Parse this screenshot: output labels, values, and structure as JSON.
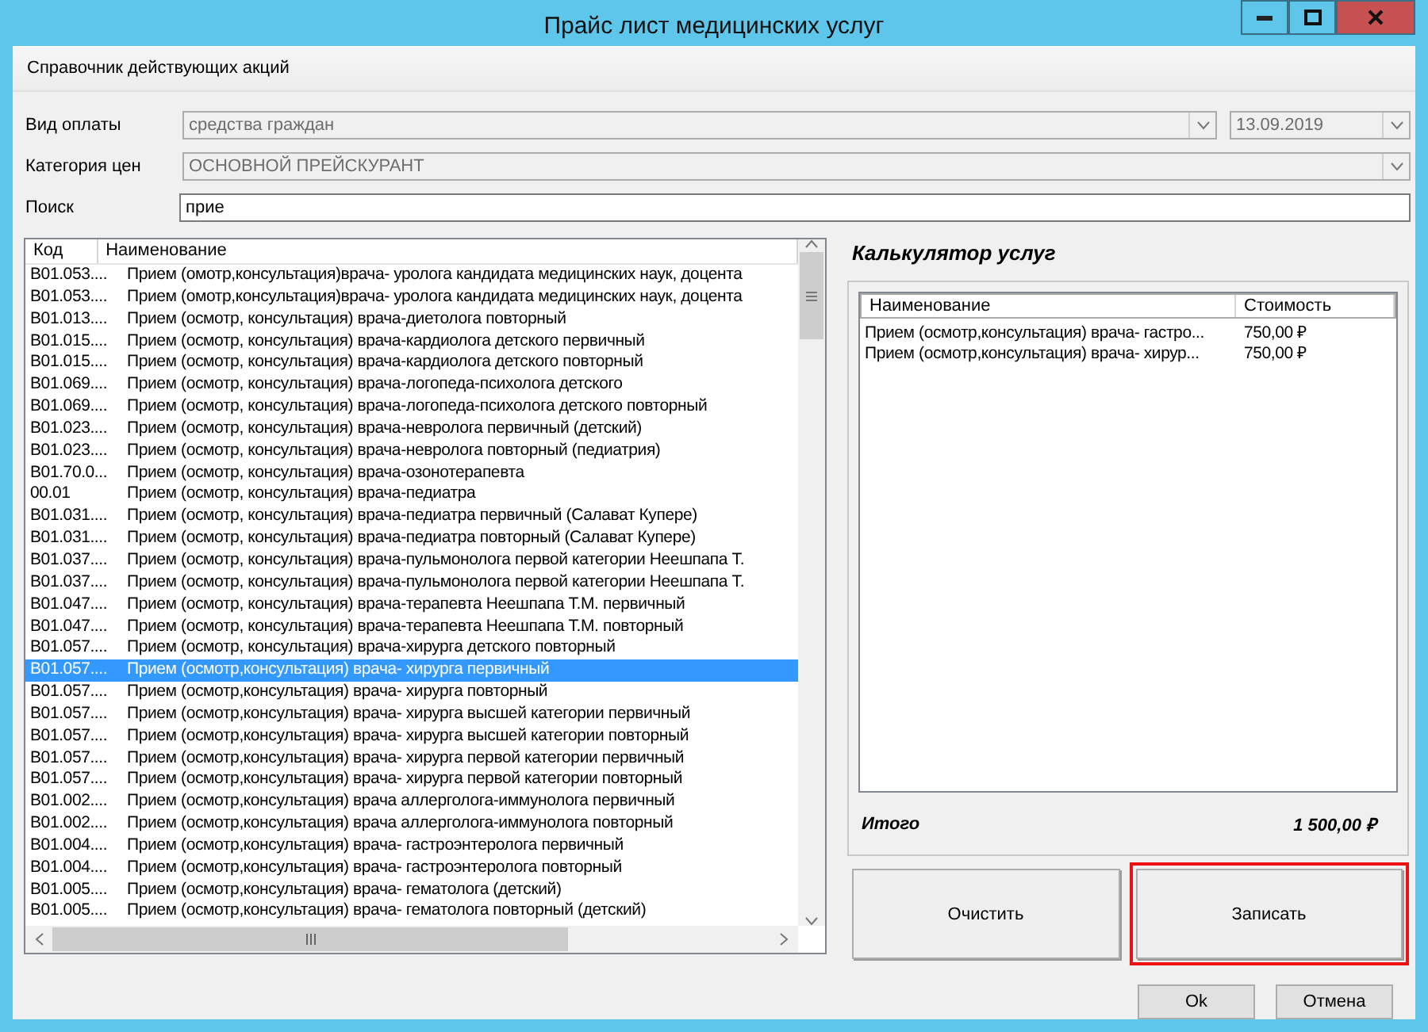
{
  "window": {
    "title": "Прайс лист медицинских услуг"
  },
  "toolbar": {
    "label": "Справочник действующих акций"
  },
  "form": {
    "payment": {
      "label": "Вид оплаты",
      "value": "средства граждан",
      "date": "13.09.2019"
    },
    "category": {
      "label": "Категория цен",
      "value": "ОСНОВНОЙ ПРЕЙСКУРАНТ"
    },
    "search": {
      "label": "Поиск",
      "value": "прие"
    }
  },
  "services": {
    "columns": [
      "Код",
      "Наименование"
    ],
    "rows": [
      {
        "code": "B01.053....",
        "name": "Прием (омотр,консультация)врача- уролога кандидата медицинских наук, доцента",
        "selected": false
      },
      {
        "code": "B01.053....",
        "name": "Прием (омотр,консультация)врача- уролога кандидата медицинских наук, доцента",
        "selected": false
      },
      {
        "code": "B01.013....",
        "name": "Прием (осмотр, консультация) врача-диетолога повторный",
        "selected": false
      },
      {
        "code": "B01.015....",
        "name": "Прием (осмотр, консультация) врача-кардиолога детского первичный",
        "selected": false
      },
      {
        "code": "B01.015....",
        "name": "Прием (осмотр, консультация) врача-кардиолога детского повторный",
        "selected": false
      },
      {
        "code": "B01.069....",
        "name": "Прием (осмотр, консультация) врача-логопеда-психолога детского",
        "selected": false
      },
      {
        "code": "B01.069....",
        "name": "Прием (осмотр, консультация) врача-логопеда-психолога детского повторный",
        "selected": false
      },
      {
        "code": "B01.023....",
        "name": "Прием (осмотр, консультация) врача-невролога первичный (детский)",
        "selected": false
      },
      {
        "code": "B01.023....",
        "name": "Прием (осмотр, консультация) врача-невролога повторный (педиатрия)",
        "selected": false
      },
      {
        "code": "B01.70.0...",
        "name": "Прием (осмотр, консультация) врача-озонотерапевта",
        "selected": false
      },
      {
        "code": "00.01",
        "name": "Прием (осмотр, консультация) врача-педиатра",
        "selected": false
      },
      {
        "code": "B01.031....",
        "name": "Прием (осмотр, консультация) врача-педиатра первичный (Салават Купере)",
        "selected": false
      },
      {
        "code": "B01.031....",
        "name": "Прием (осмотр, консультация) врача-педиатра повторный (Салават Купере)",
        "selected": false
      },
      {
        "code": "B01.037....",
        "name": "Прием (осмотр, консультация) врача-пульмонолога первой категории Неешпапа Т.",
        "selected": false
      },
      {
        "code": "B01.037....",
        "name": "Прием (осмотр, консультация) врача-пульмонолога первой категории Неешпапа Т.",
        "selected": false
      },
      {
        "code": "B01.047....",
        "name": "Прием (осмотр, консультация) врача-терапевта Неешпапа Т.М. первичный",
        "selected": false
      },
      {
        "code": "B01.047....",
        "name": "Прием (осмотр, консультация) врача-терапевта Неешпапа Т.М. повторный",
        "selected": false
      },
      {
        "code": "B01.057....",
        "name": "Прием (осмотр, консультация) врача-хирурга детского повторный",
        "selected": false
      },
      {
        "code": "B01.057....",
        "name": "Прием (осмотр,консультация)  врача- хирурга  первичный",
        "selected": true
      },
      {
        "code": "B01.057....",
        "name": "Прием (осмотр,консультация)  врача- хирурга  повторный",
        "selected": false
      },
      {
        "code": "B01.057....",
        "name": "Прием (осмотр,консультация)  врача- хирурга высшей категории первичный",
        "selected": false
      },
      {
        "code": "B01.057....",
        "name": "Прием (осмотр,консультация)  врача- хирурга высшей категории повторный",
        "selected": false
      },
      {
        "code": "B01.057....",
        "name": "Прием (осмотр,консультация)  врача- хирурга первой категории первичный",
        "selected": false
      },
      {
        "code": "B01.057....",
        "name": "Прием (осмотр,консультация)  врача- хирурга первой категории повторный",
        "selected": false
      },
      {
        "code": "B01.002....",
        "name": "Прием (осмотр,консультация) врача аллерголога-иммунолога первичный",
        "selected": false
      },
      {
        "code": "B01.002....",
        "name": "Прием (осмотр,консультация) врача аллерголога-иммунолога повторный",
        "selected": false
      },
      {
        "code": "B01.004....",
        "name": "Прием (осмотр,консультация) врача- гастроэнтеролога первичный",
        "selected": false
      },
      {
        "code": "B01.004....",
        "name": "Прием (осмотр,консультация) врача- гастроэнтеролога повторный",
        "selected": false
      },
      {
        "code": "B01.005....",
        "name": "Прием (осмотр,консультация) врача- гематолога (детский)",
        "selected": false
      },
      {
        "code": "B01.005....",
        "name": "Прием (осмотр,консультация) врача- гематолога повторный (детский)",
        "selected": false
      }
    ]
  },
  "calculator": {
    "title": "Калькулятор услуг",
    "columns": [
      "Наименование",
      "Стоимость"
    ],
    "rows": [
      {
        "name": "Прием (осмотр,консультация) врача- гастро...",
        "price": "750,00 ₽"
      },
      {
        "name": "Прием (осмотр,консультация)  врача- хирур...",
        "price": "750,00 ₽"
      }
    ],
    "total_label": "Итого",
    "total": "1 500,00 ₽"
  },
  "actions": [
    {
      "label": "Очистить",
      "highlighted": false
    },
    {
      "label": "Записать",
      "highlighted": true
    }
  ],
  "buttons": [
    "Ok",
    "Отмена"
  ]
}
